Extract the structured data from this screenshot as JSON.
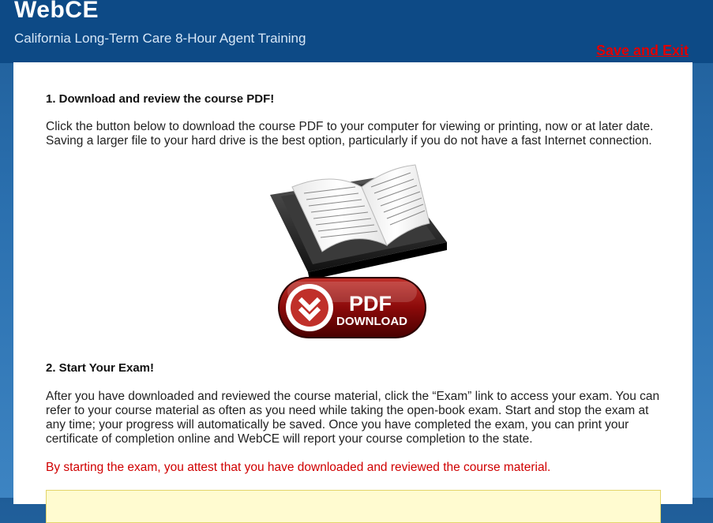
{
  "header": {
    "logo": "WebCE",
    "logo_mark": "®",
    "course_title": "California Long-Term Care 8-Hour Agent Training",
    "save_exit": "Save and Exit"
  },
  "section1": {
    "heading": "1. Download and review the course PDF!",
    "body": "Click the button below to download the course PDF to your computer for viewing or printing, now or at later date. Saving a larger file to your hard drive is the best option, particularly if you do not have a fast Internet connection."
  },
  "pdf_button": {
    "line1": "PDF",
    "line2": "DOWNLOAD",
    "icon": "double-chevron-down-icon"
  },
  "section2": {
    "heading": "2. Start Your Exam!",
    "body": "After you have downloaded and reviewed the course material, click the “Exam” link to access your exam. You can refer to your course material as often as you need while taking the open-book exam. Start and stop the exam at any time; your progress will automatically be saved. Once you have completed the exam, you can print your certificate of completion online and WebCE will report your course completion to the state.",
    "attest": "By starting the exam, you attest that you have downloaded and reviewed the course material."
  },
  "colors": {
    "accent": "#0d4a86",
    "warning": "#e00000",
    "button": "#8b0a0a"
  }
}
